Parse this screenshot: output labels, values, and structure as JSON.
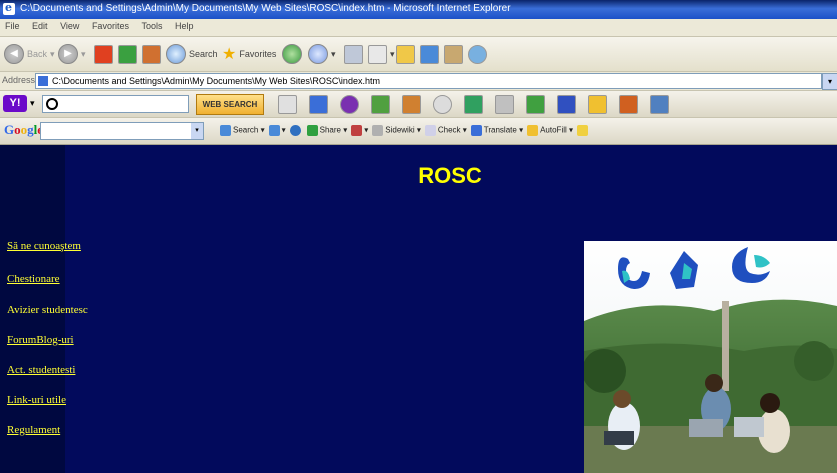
{
  "window": {
    "title": "C:\\Documents and Settings\\Admin\\My Documents\\My Web Sites\\ROSC\\index.htm - Microsoft Internet Explorer"
  },
  "menu": [
    "File",
    "Edit",
    "View",
    "Favorites",
    "Tools",
    "Help"
  ],
  "toolbar": {
    "back": "Back",
    "search": "Search",
    "favorites": "Favorites"
  },
  "address": {
    "label": "Address",
    "url": "C:\\Documents and Settings\\Admin\\My Documents\\My Web Sites\\ROSC\\index.htm"
  },
  "yahoo": {
    "logo": "Y!",
    "button": "WEB SEARCH"
  },
  "google": {
    "logo": "Google",
    "items": [
      "Search",
      "Share",
      "Sidewiki",
      "Check",
      "Translate",
      "AutoFill"
    ]
  },
  "page": {
    "title": "ROSC",
    "nav": [
      {
        "label": "Să ne cunoaştem",
        "link": true
      },
      {
        "label": "Chestionare",
        "link": true
      },
      {
        "label": "Avizier studentesc",
        "link": false
      },
      {
        "label": "ForumBlog-uri",
        "link": true
      },
      {
        "label": "Act. studentesti",
        "link": true
      },
      {
        "label": "Link-uri utile",
        "link": true
      },
      {
        "label": "Regulament",
        "link": true
      }
    ]
  },
  "colors": {
    "page_bg": "#020a5c",
    "link": "#ffff33",
    "title": "#ffff00"
  }
}
